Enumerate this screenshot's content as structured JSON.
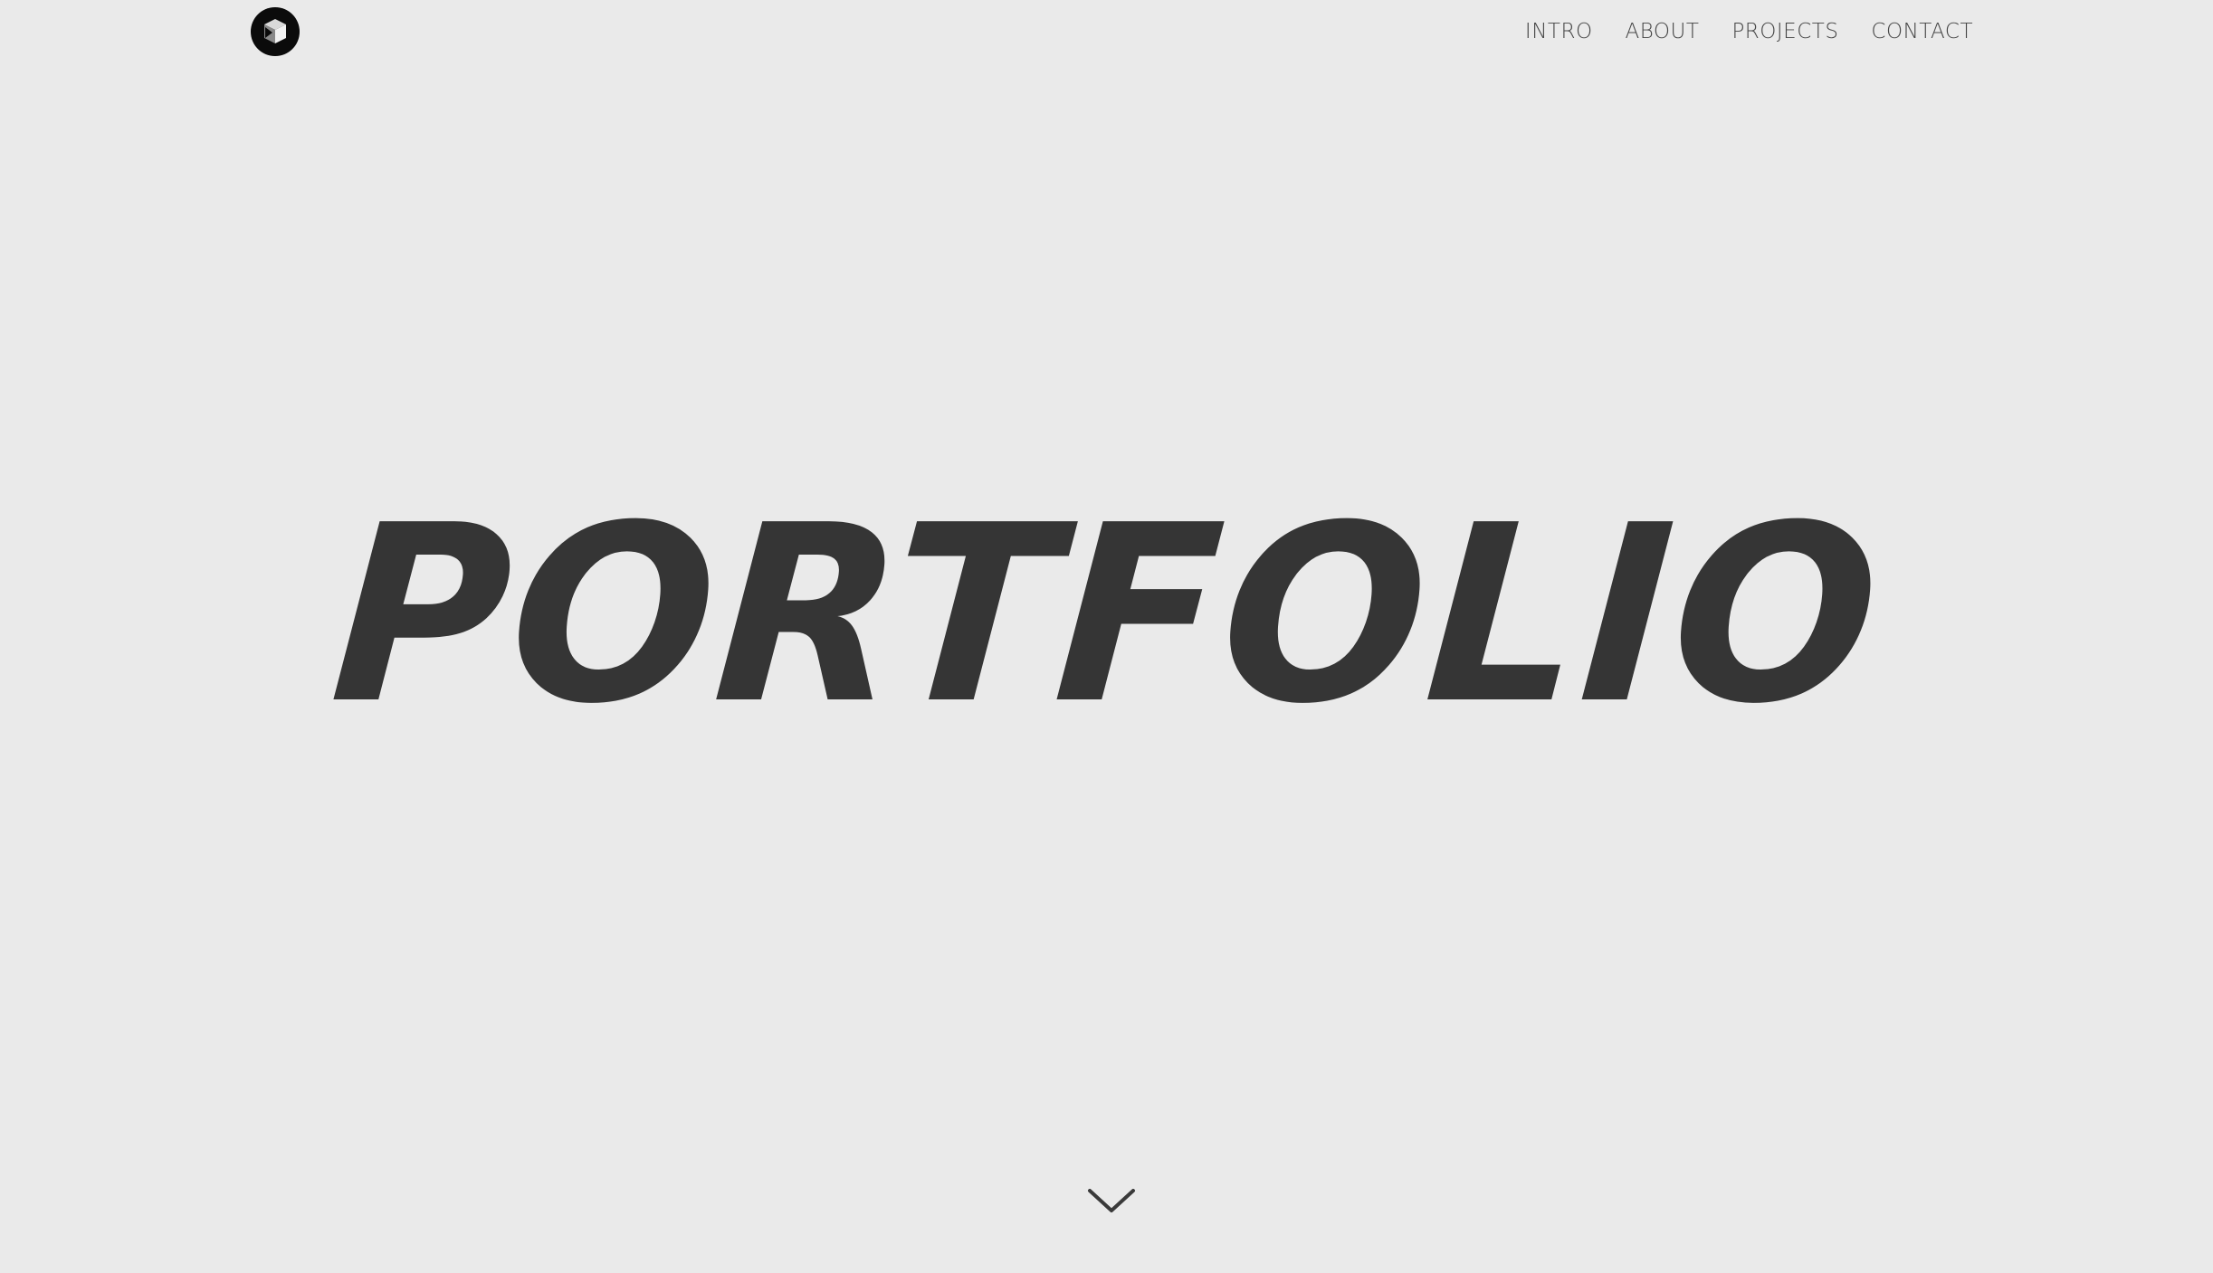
{
  "header": {
    "logo_icon": "cube-logo-icon",
    "nav": [
      {
        "label": "INTRO"
      },
      {
        "label": "ABOUT"
      },
      {
        "label": "PROJECTS"
      },
      {
        "label": "CONTACT"
      }
    ]
  },
  "hero": {
    "title": "PORTFOLIO",
    "scroll_icon": "chevron-down-icon"
  },
  "colors": {
    "background": "#eaeaea",
    "title": "#353535",
    "nav_text": "#454545",
    "logo_bg": "#0b0b0b"
  }
}
